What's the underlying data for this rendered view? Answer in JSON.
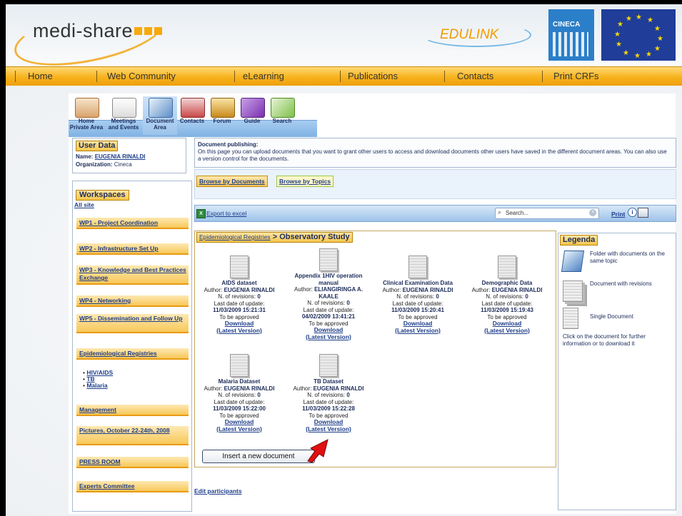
{
  "banner": {
    "logo_text": "medi-share",
    "partner1": "EDULINK",
    "partner2": "CINECA"
  },
  "nav": {
    "items": [
      "Home",
      "Web Community",
      "eLearning",
      "Publications",
      "Contacts",
      "Print CRFs"
    ]
  },
  "toolbar": {
    "home": [
      "Home",
      "Private Area"
    ],
    "meetings": [
      "Meetings",
      "and Events"
    ],
    "document": [
      "Document",
      "Area"
    ],
    "contacts": "Contacts",
    "forum": "Forum",
    "guide": "Guide",
    "search": "Search"
  },
  "user": {
    "heading": "User Data",
    "name_label": "Name:",
    "name_value": "EUGENIA RINALDI",
    "org_label": "Organization:",
    "org_value": "Cineca"
  },
  "workspaces": {
    "heading": "Workspaces",
    "all_site": "All site",
    "items": [
      "WP1 - Project Coordination",
      "WP2 - Infrastructure Set Up",
      "WP3 - Knowledge and Best Practices Exchange",
      "WP4 - Networking",
      "WP5 - Dissemination and Follow Up",
      "Epidemiological Registries"
    ],
    "subitems": [
      "HIV/AIDS",
      "TB",
      "Malaria"
    ],
    "more": [
      "Management",
      "Pictures, October 22-24th, 2008",
      "PRESS ROOM",
      "Experts Committee"
    ]
  },
  "info": {
    "title": "Document publishing:",
    "text": "On this page you can upload documents that you want to grant other users to access and download documents other users have saved in the different document areas. You can also use a version control for the documents."
  },
  "tabs": {
    "documents": "Browse by Documents",
    "topics": "Browse by Topics"
  },
  "actions": {
    "export": "Export to excel",
    "search_placeholder": "Search...",
    "print": "Print"
  },
  "breadcrumb": {
    "parent": "Epidemiological Registries",
    "sep": " > ",
    "current": "Observatory Study"
  },
  "doc_labels": {
    "author": "Author:",
    "revisions": "N. of revisions:",
    "date": "Last date of update:",
    "status": "To be approved",
    "download": "Download",
    "latest": "(Latest Version)"
  },
  "documents": [
    {
      "title": "AIDS dataset",
      "author": "EUGENIA RINALDI",
      "revisions": "0",
      "date": "11/03/2009 15:21:31"
    },
    {
      "title": "Appendix 1HIV operation manual",
      "author": "ELIANGIRINGA A. KAALE",
      "revisions": "0",
      "date": "04/02/2009 13:41:21"
    },
    {
      "title": "Clinical Examination Data",
      "author": "EUGENIA RINALDI",
      "revisions": "0",
      "date": "11/03/2009 15:20:41"
    },
    {
      "title": "Demographic Data",
      "author": "EUGENIA RINALDI",
      "revisions": "0",
      "date": "11/03/2009 15:19:43"
    },
    {
      "title": "Malaria Dataset",
      "author": "EUGENIA RINALDI",
      "revisions": "0",
      "date": "11/03/2009 15:22:00"
    },
    {
      "title": "TB Dataset",
      "author": "EUGENIA RINALDI",
      "revisions": "0",
      "date": "11/03/2009 15:22:28"
    }
  ],
  "insert_button": "Insert a new document",
  "edit_participants": "Edit participants",
  "legenda": {
    "heading": "Legenda",
    "folder": "Folder with documents on the same topic",
    "revisions": "Document with revisions",
    "single": "Single Document",
    "hint": "Click on the document for further information or to download it"
  },
  "colors": {
    "nav_orange": "#f7b21c",
    "toolbar_blue": "#7fb2e4",
    "link_blue": "#1e3e8a",
    "arrow_red": "#e01010"
  }
}
